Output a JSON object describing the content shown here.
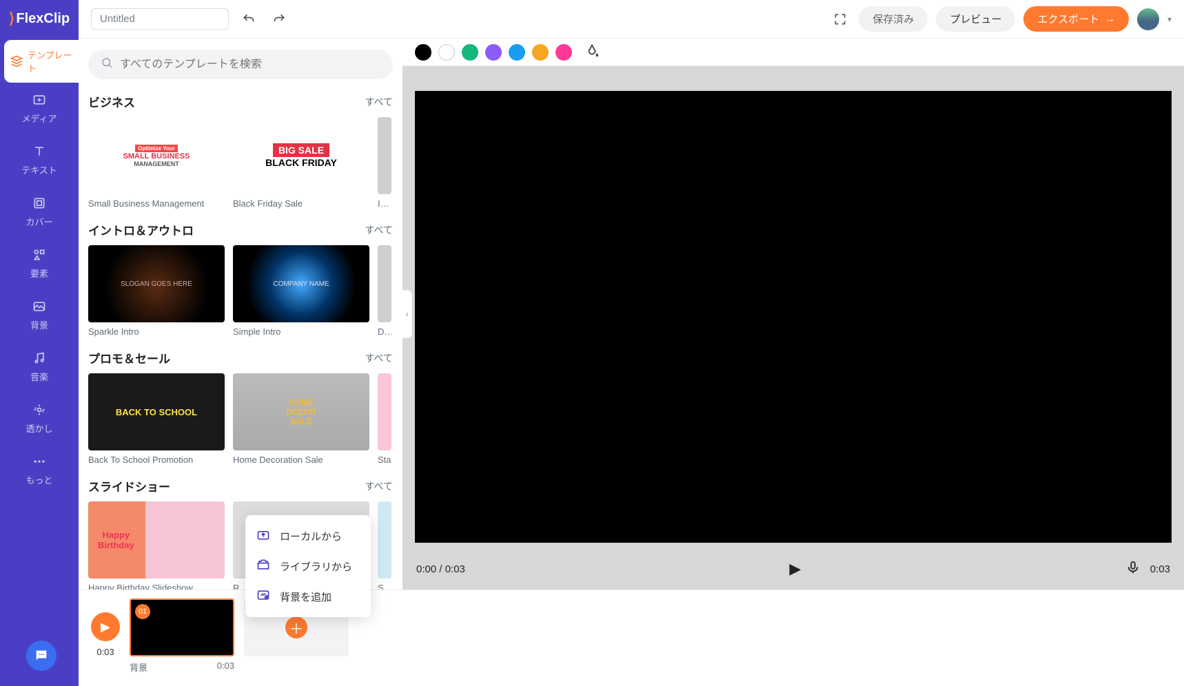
{
  "logo": "FlexClip",
  "topbar": {
    "title_value": "Untitled",
    "saved": "保存済み",
    "preview": "プレビュー",
    "export": "エクスポート"
  },
  "sidebar": {
    "items": [
      {
        "label": "テンプレート"
      },
      {
        "label": "メディア"
      },
      {
        "label": "テキスト"
      },
      {
        "label": "カバー"
      },
      {
        "label": "要素"
      },
      {
        "label": "背景"
      },
      {
        "label": "音楽"
      },
      {
        "label": "透かし"
      },
      {
        "label": "もっと"
      }
    ]
  },
  "panel": {
    "search_placeholder": "すべてのテンプレートを検索",
    "see_all": "すべて",
    "sections": [
      {
        "title": "ビジネス",
        "cards": [
          {
            "label": "Small Business Management",
            "thumb_lines": [
              "Optimize Your",
              "SMALL BUSINESS",
              "MANAGEMENT"
            ]
          },
          {
            "label": "Black Friday Sale",
            "thumb_lines": [
              "BIG SALE",
              "BLACK FRIDAY"
            ]
          },
          {
            "label": "Inte"
          }
        ]
      },
      {
        "title": "イントロ＆アウトロ",
        "cards": [
          {
            "label": "Sparkle Intro",
            "thumb_lines": [
              "SLOGAN GOES HERE"
            ]
          },
          {
            "label": "Simple Intro",
            "thumb_lines": [
              "COMPANY NAME"
            ]
          },
          {
            "label": "Dyr"
          }
        ]
      },
      {
        "title": "プロモ＆セール",
        "cards": [
          {
            "label": "Back To School Promotion",
            "thumb_lines": [
              "BACK TO SCHOOL"
            ]
          },
          {
            "label": "Home Decoration Sale",
            "thumb_lines": [
              "HOME",
              "DECOR",
              "SALE"
            ]
          },
          {
            "label": "Sta"
          }
        ]
      },
      {
        "title": "スライドショー",
        "cards": [
          {
            "label": "Happy Birthday Slideshow",
            "thumb_lines": [
              "Happy",
              "Birthday"
            ]
          },
          {
            "label": "R"
          },
          {
            "label": "Sur"
          }
        ]
      }
    ]
  },
  "swatches": [
    "#000000",
    "#ffffff",
    "#14b77c",
    "#8b5cf6",
    "#1a9dee",
    "#f5a623",
    "#ff3797"
  ],
  "player": {
    "time": "0:00 / 0:03",
    "end_time": "0:03"
  },
  "timeline": {
    "play_time": "0:03",
    "clip_badge": "01",
    "clip_label": "背景",
    "clip_duration": "0:03"
  },
  "popover": {
    "items": [
      {
        "label": "ローカルから"
      },
      {
        "label": "ライブラリから"
      },
      {
        "label": "背景を追加"
      }
    ]
  }
}
